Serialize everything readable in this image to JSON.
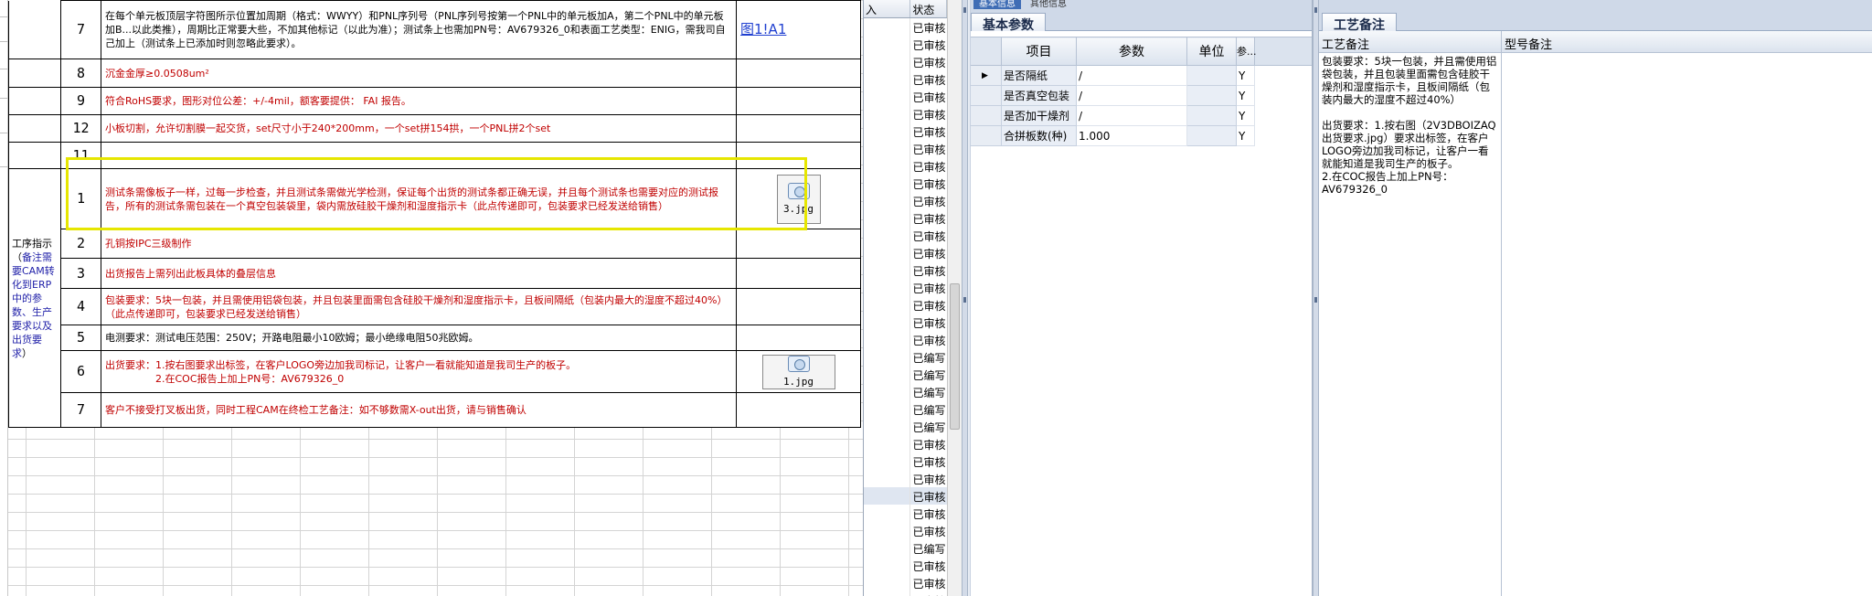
{
  "sheet": {
    "row_top": {
      "num": "7",
      "text": "在每个单元板顶层字符图所示位置加周期（格式：WWYY）和PNL序列号（PNL序列号按第一个PNL中的单元板加A，第二个PNL中的单元板加B...以此类推），周期比正常要大些，不加其他标记（以此为准）；测试条上也需加PN号：AV679326_0和表面工艺类型：ENIG，需我司自己加上（测试条上已添加时则忽略此要求）。",
      "link": "图1!A1"
    },
    "rows_mid": [
      {
        "num": "8",
        "text": "沉金金厚≥0.0508um²"
      },
      {
        "num": "9",
        "text": "符合RoHS要求，图形对位公差：+/-4mil，额客要提供： FAI 报告。"
      },
      {
        "num": "12",
        "text": "小板切割，允许切割膜一起交货，set尺寸小于240*200mm，一个set拼154拱，一个PNL拼2个set"
      },
      {
        "num": "11",
        "text": ""
      }
    ],
    "section_label": {
      "prefix": "工序指示（",
      "blue": "备注需要CAM转化到ERP中的参数、生产要求以及出货要求",
      "suffix": "）"
    },
    "rows_section": [
      {
        "num": "1",
        "text": "测试条需像板子一样，过每一步检查，并且测试条需做光学检测，保证每个出货的测试条都正确无误，并且每个测试条也需要对应的测试报告，所有的测试条需包装在一个真空包装袋里，袋内需放硅胶干燥剂和湿度指示卡（此点传递即可，包装要求已经发送给销售）",
        "attachment": "3.jpg",
        "red": true
      },
      {
        "num": "2",
        "text": "孔铜按IPC三级制作",
        "red": true
      },
      {
        "num": "3",
        "text": "出货报告上需列出此板具体的叠层信息",
        "red": true
      },
      {
        "num": "4",
        "text": "包装要求：5块一包装，并且需使用铝袋包装，并且包装里面需包含硅胶干燥剂和湿度指示卡，且板间隔纸（包装内最大的湿度不超过40%）（此点传递即可，包装要求已经发送给销售）",
        "red": true
      },
      {
        "num": "5",
        "text": "电测要求：测试电压范围：250V；开路电阻最小10欧姆；最小绝缘电阻50兆欧姆。",
        "red": false
      },
      {
        "num": "6",
        "text": "出货要求：1.按右图要求出标签，在客户LOGO旁边加我司标记，让客户一看就能知道是我司生产的板子。\n　　　　　2.在COC报告上加上PN号：AV679326_0",
        "attachment": "1.jpg",
        "red": true
      },
      {
        "num": "7",
        "text": "客户不接受打叉板出货，同时工程CAM在终检工艺备注：如不够数需X-out出货，请与销售确认",
        "red": true
      }
    ]
  },
  "status_col": {
    "headers": [
      "入",
      "状态"
    ],
    "values": [
      "已审核",
      "已审核",
      "已审核",
      "已审核",
      "已审核",
      "已审核",
      "已审核",
      "已审核",
      "已审核",
      "已审核",
      "已审核",
      "已审核",
      "已审核",
      "已审核",
      "已审核",
      "已审核",
      "已审核",
      "已审核",
      "已审核",
      "已编写",
      "已编写",
      "已编写",
      "已编写",
      "已编写",
      "已审核",
      "已审核",
      "已审核",
      "已审核",
      "已审核",
      "已审核",
      "已编写",
      "已审核",
      "已审核",
      "已审核"
    ]
  },
  "params_panel": {
    "top_tabs": [
      "基本信息",
      "其他信息"
    ],
    "tab": "基本参数",
    "headers": [
      "项目",
      "参数",
      "单位",
      "参..."
    ],
    "rows": [
      {
        "item": "是否隔纸",
        "value": "/",
        "unit": "",
        "flag": "Y"
      },
      {
        "item": "是否真空包装",
        "value": "/",
        "unit": "",
        "flag": "Y"
      },
      {
        "item": "是否加干燥剂",
        "value": "/",
        "unit": "",
        "flag": "Y"
      },
      {
        "item": "合拼板数(种)",
        "value": "1.000",
        "unit": "",
        "flag": "Y"
      }
    ]
  },
  "notes_panel": {
    "tab": "工艺备注",
    "headers": [
      "工艺备注",
      "型号备注"
    ],
    "process_note": "包装要求：5块一包装，并且需使用铝袋包装，并且包装里面需包含硅胶干燥剂和湿度指示卡，且板间隔纸（包装内最大的湿度不超过40%）\n\n出货要求：1.按右图（2V3DBOIZAQ出货要求.jpg）要求出标签，在客户LOGO旁边加我司标记，让客户一看就能知道是我司生产的板子。\n2.在COC报告上加上PN号：AV679326_0",
    "model_note": ""
  }
}
